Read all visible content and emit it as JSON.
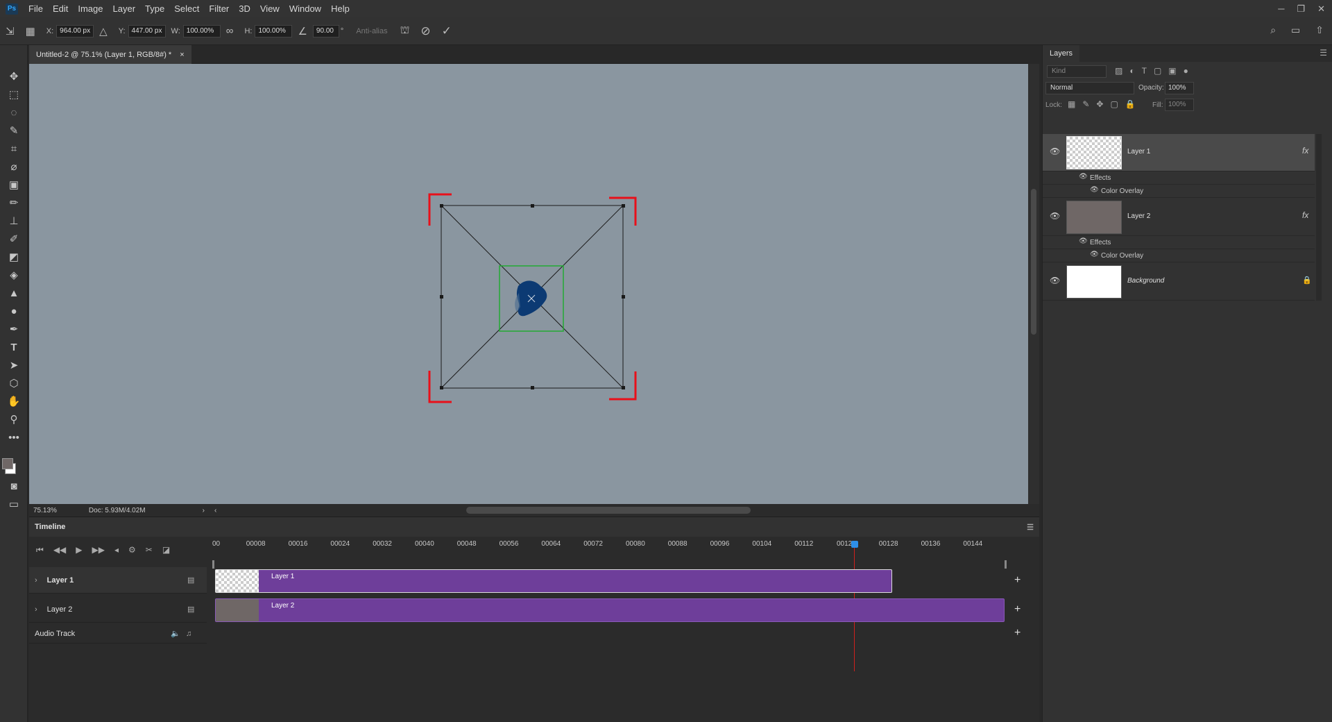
{
  "app": {
    "logo": "Ps"
  },
  "menu": [
    "File",
    "Edit",
    "Image",
    "Layer",
    "Type",
    "Select",
    "Filter",
    "3D",
    "View",
    "Window",
    "Help"
  ],
  "window_controls": {
    "minimize": "─",
    "restore": "❐",
    "close": "✕"
  },
  "options": {
    "x_label": "X:",
    "x_value": "964.00 px",
    "y_label": "Y:",
    "y_value": "447.00 px",
    "w_label": "W:",
    "w_value": "100.00%",
    "h_label": "H:",
    "h_value": "100.00%",
    "angle_value": "90.00",
    "angle_unit": "°",
    "antialias_label": "Anti-alias"
  },
  "document": {
    "tab_title": "Untitled-2 @ 75.1% (Layer 1, RGB/8#) *",
    "tab_close": "×",
    "zoom": "75.13%",
    "doc_info": "Doc: 5.93M/4.02M"
  },
  "timeline": {
    "title": "Timeline",
    "ticks": [
      "00",
      "00008",
      "00016",
      "00024",
      "00032",
      "00040",
      "00048",
      "00056",
      "00064",
      "00072",
      "00080",
      "00088",
      "00096",
      "00104",
      "00112",
      "00120",
      "00128",
      "00136",
      "00144"
    ],
    "tracks": [
      {
        "name": "Layer 1",
        "clip_label": "Layer 1"
      },
      {
        "name": "Layer 2",
        "clip_label": "Layer 2"
      }
    ],
    "audio_track": "Audio Track",
    "playhead_frame": "00120"
  },
  "layers_panel": {
    "title": "Layers",
    "kind_placeholder": "Kind",
    "blend_mode": "Normal",
    "opacity_label": "Opacity:",
    "opacity_value": "100%",
    "lock_label": "Lock:",
    "fill_label": "Fill:",
    "fill_value": "100%",
    "layers": [
      {
        "name": "Layer 1",
        "effects_label": "Effects",
        "effect": "Color Overlay",
        "fx": "fx"
      },
      {
        "name": "Layer 2",
        "effects_label": "Effects",
        "effect": "Color Overlay",
        "fx": "fx"
      },
      {
        "name": "Background"
      }
    ]
  },
  "colors": {
    "canvas": "#8a96a0",
    "clip": "#6e3e9a",
    "layer2_fill": "#6f6766",
    "blob": "#0c3a73",
    "transform_corners": "#e8101a",
    "selection_box": "#22aa33",
    "playhead": "#d0201e"
  }
}
